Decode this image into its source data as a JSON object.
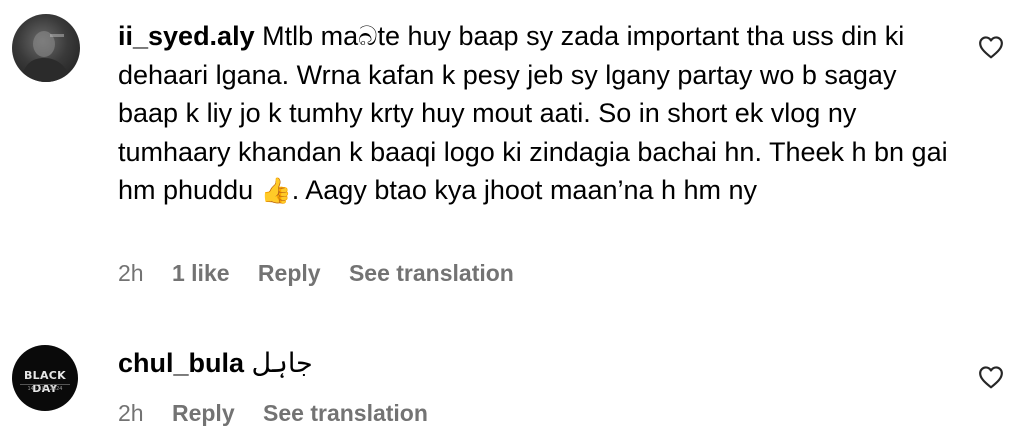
{
  "comments": [
    {
      "username": "ii_syed.aly",
      "text": "Mtlb maබte huy baap sy zada important tha uss din ki dehaari lgana. Wrna kafan k pesy jeb sy lgany partay wo b sagay baap k liy jo k tumhy krty huy mout aati. So in short ek vlog ny tumhaary khandan k baaqi logo ki zindagia bachai hn. Theek h bn gai hm phuddu",
      "emoji": "👍",
      "text_after": ". Aagy btao kya jhoot maan’na h hm ny",
      "time": "2h",
      "likes": "1 like",
      "reply": "Reply",
      "translate": "See translation",
      "avatar_icon": "profile-photo"
    },
    {
      "username": "chul_bula",
      "text": "جاہل",
      "time": "2h",
      "reply": "Reply",
      "translate": "See translation",
      "avatar_text": "BLACK DAY",
      "avatar_subtext": "14 · 10 · 2024",
      "avatar_icon": "black-day-badge"
    }
  ],
  "colors": {
    "meta": "#737373",
    "text": "#000000",
    "heart": "#262626"
  }
}
